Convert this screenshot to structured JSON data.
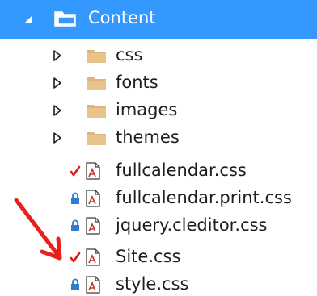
{
  "tree": {
    "root": {
      "label": "Content",
      "expanded": true,
      "icon": "folder-open-icon",
      "selected": true
    },
    "folders": [
      {
        "label": "css",
        "icon": "folder-icon",
        "expander": "collapsed-triangle-icon"
      },
      {
        "label": "fonts",
        "icon": "folder-icon",
        "expander": "collapsed-triangle-icon"
      },
      {
        "label": "images",
        "icon": "folder-icon",
        "expander": "collapsed-triangle-icon"
      },
      {
        "label": "themes",
        "icon": "folder-icon",
        "expander": "collapsed-triangle-icon"
      }
    ],
    "files": [
      {
        "label": "fullcalendar.css",
        "status": "checked-out-checkmark-icon",
        "icon": "css-file-icon"
      },
      {
        "label": "fullcalendar.print.css",
        "status": "locked-icon",
        "icon": "css-file-icon"
      },
      {
        "label": "jquery.cleditor.css",
        "status": "locked-icon",
        "icon": "css-file-icon"
      },
      {
        "label": "Site.css",
        "status": "checked-out-checkmark-icon",
        "icon": "css-file-icon"
      },
      {
        "label": "style.css",
        "status": "locked-icon",
        "icon": "css-file-icon"
      }
    ]
  },
  "annotation": {
    "icon": "red-arrow-icon",
    "color": "#e8201a"
  },
  "colors": {
    "selection": "#3399ff",
    "folder": "#dcb67a",
    "checkmark": "#d0201c",
    "lock": "#2e7bcf"
  }
}
